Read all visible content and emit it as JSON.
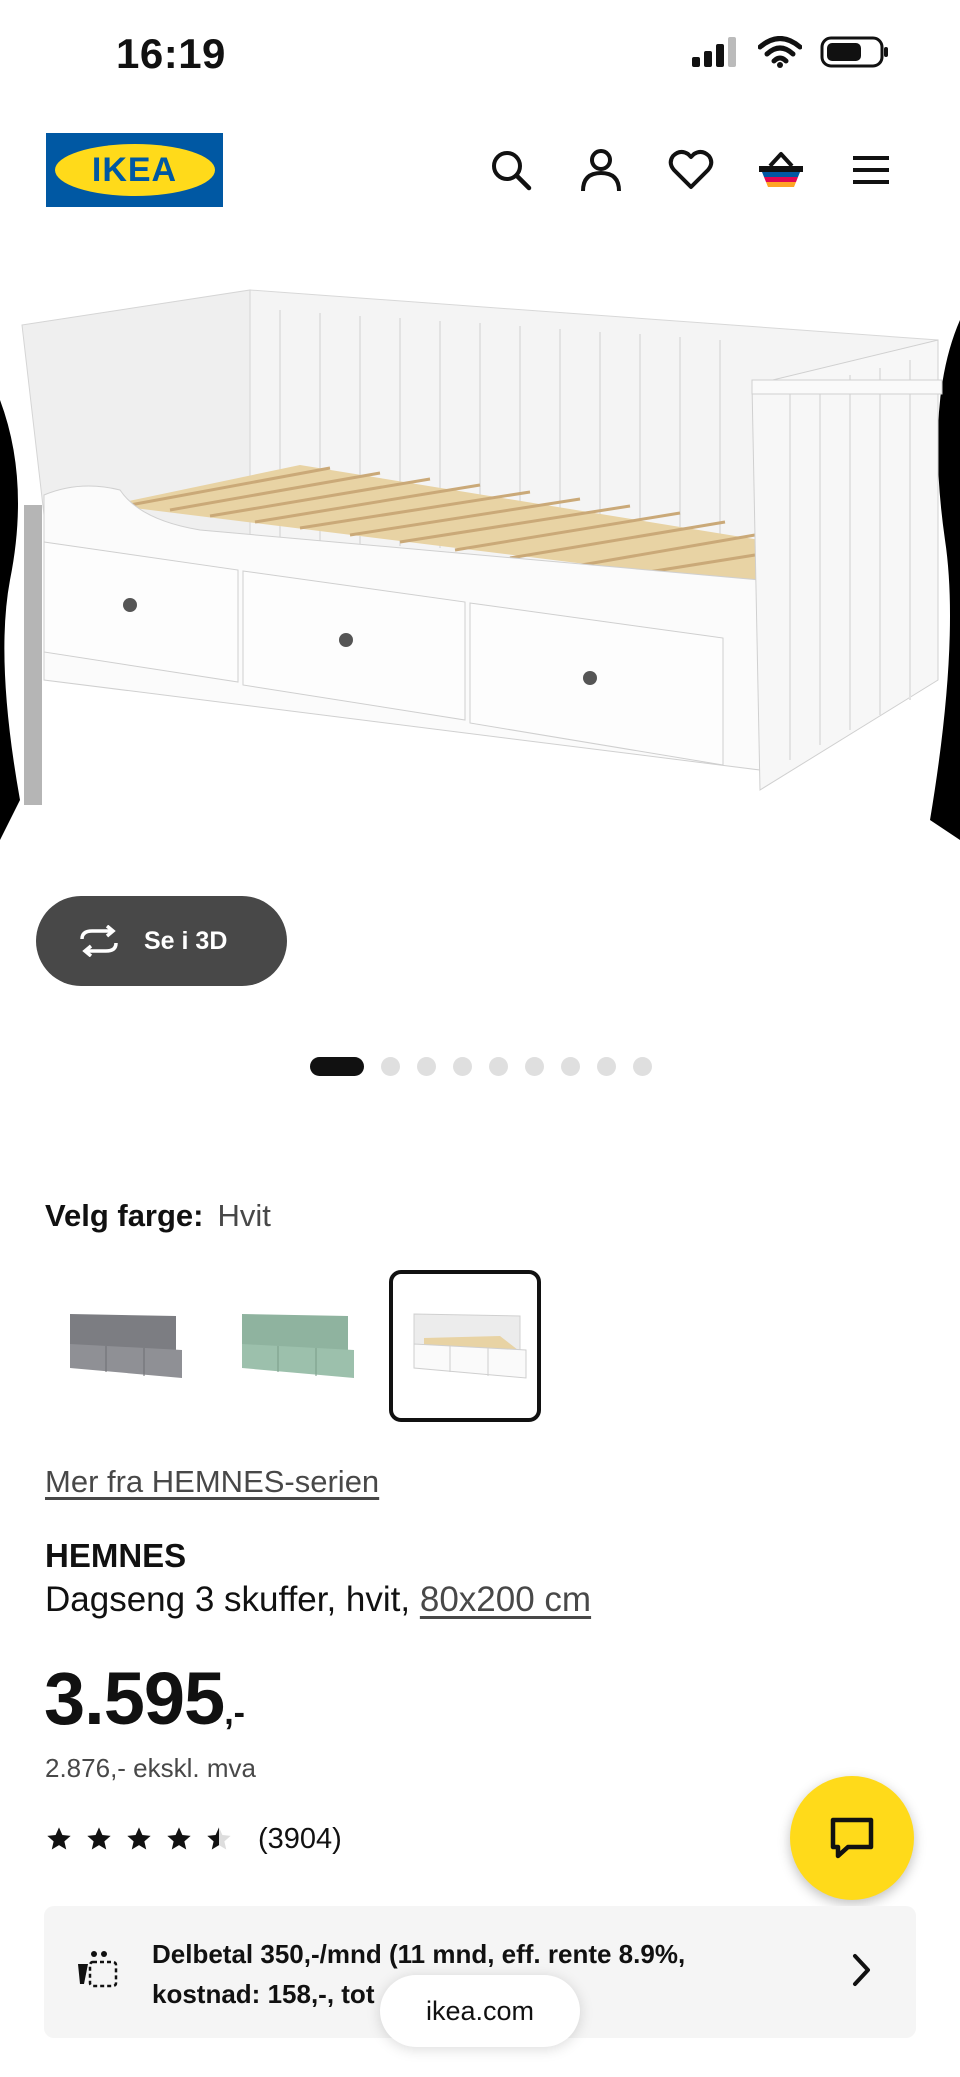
{
  "status_bar": {
    "time": "16:19"
  },
  "header": {
    "logo_text": "IKEA",
    "icons": [
      "search-icon",
      "profile-icon",
      "heart-icon",
      "basket-icon",
      "menu-icon"
    ]
  },
  "gallery": {
    "view_3d_label": "Se i 3D",
    "dot_count": 9,
    "active_dot": 0
  },
  "color_picker": {
    "label": "Velg farge:",
    "selected_value": "Hvit",
    "options": [
      {
        "color": "grey"
      },
      {
        "color": "green"
      },
      {
        "color": "white"
      }
    ],
    "selected_index": 2
  },
  "series_link": "Mer fra HEMNES-serien",
  "product": {
    "name": "HEMNES",
    "description": "Dagseng 3 skuffer, hvit,",
    "size": "80x200 cm",
    "price": "3.595",
    "price_suffix": ",-",
    "price_excl": "2.876,- ekskl. mva",
    "rating": 4.5,
    "rating_count": "(3904)"
  },
  "finance_banner": {
    "line1": "Delbetal 350,-/mnd (11 mnd, eff. rente 8.9%,",
    "line2": "kostnad: 158,-, tot"
  },
  "url_bar": {
    "url": "ikea.com"
  },
  "colors": {
    "ikea_blue": "#0058a3",
    "ikea_yellow": "#ffda1a",
    "dark_button": "#484848"
  }
}
